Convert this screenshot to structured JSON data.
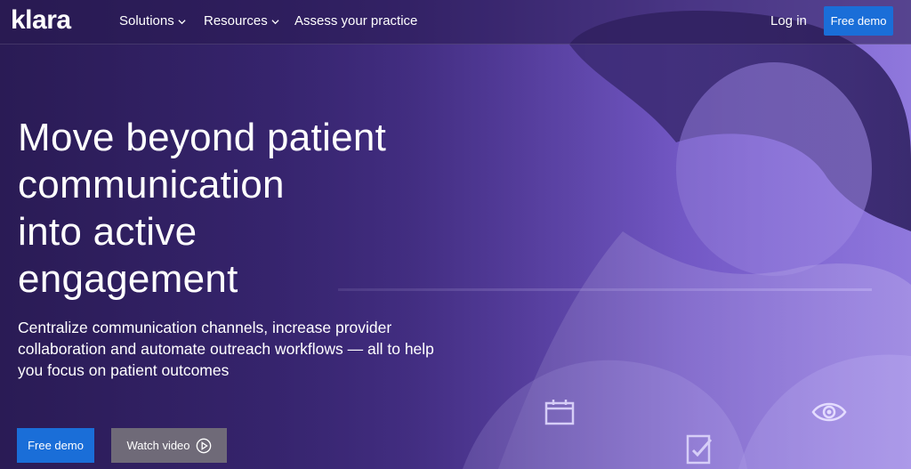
{
  "nav": {
    "logo": "klara",
    "items": [
      {
        "label": "Solutions",
        "has_dropdown": true
      },
      {
        "label": "Resources",
        "has_dropdown": true
      },
      {
        "label": "Assess your practice",
        "has_dropdown": false
      }
    ],
    "login": "Log in",
    "cta": "Free demo"
  },
  "hero": {
    "headline_lines": [
      "Move beyond patient",
      "communication",
      "into active",
      "engagement"
    ],
    "subtext": "Centralize communication channels, increase provider collaboration and automate outreach workflows — all to help you focus on patient outcomes",
    "primary_button": "Free demo",
    "secondary_button": "Watch video",
    "decor_icons": [
      "calendar-icon",
      "checklist-icon",
      "eye-icon"
    ]
  },
  "colors": {
    "cta_blue": "#1a6ed8",
    "video_button_gray": "#6f6a78",
    "hero_dark": "#2a1b55",
    "hero_light": "#8f78dc"
  }
}
